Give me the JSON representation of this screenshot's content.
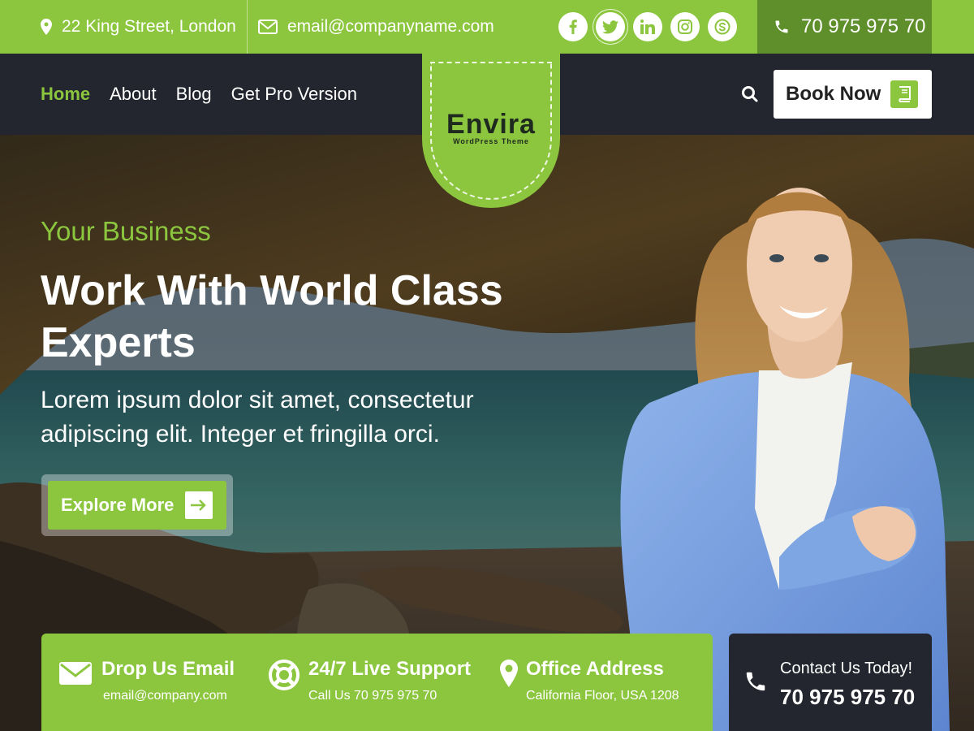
{
  "topbar": {
    "address": "22 King Street, London",
    "email": "email@companyname.com",
    "phone": "70 975 975 70",
    "social": [
      {
        "icon": "facebook-icon",
        "glyph": "f"
      },
      {
        "icon": "twitter-icon",
        "glyph": "t"
      },
      {
        "icon": "linkedin-icon",
        "glyph": "in"
      },
      {
        "icon": "instagram-icon",
        "glyph": "◎"
      },
      {
        "icon": "skype-icon",
        "glyph": "S"
      }
    ]
  },
  "nav": {
    "items": [
      "Home",
      "About",
      "Blog",
      "Get Pro Version"
    ],
    "active": "Home",
    "book_label": "Book Now"
  },
  "logo": {
    "name": "Envira",
    "tagline": "WordPress Theme"
  },
  "hero": {
    "subtitle": "Your Business",
    "title": "Work With World Class Experts",
    "description": "Lorem ipsum dolor sit amet, consectetur adipiscing elit. Integer et fringilla orci.",
    "button_label": "Explore More"
  },
  "info": [
    {
      "title": "Drop Us Email",
      "detail": "email@company.com",
      "icon": "envelope-icon"
    },
    {
      "title": "24/7 Live Support",
      "detail": "Call Us 70 975 975 70",
      "icon": "lifebuoy-icon"
    },
    {
      "title": "Office Address",
      "detail": "California Floor, USA 1208",
      "icon": "map-pin-icon"
    }
  ],
  "contact": {
    "title": "Contact Us Today!",
    "number": "70 975 975 70",
    "icon": "phone-icon"
  },
  "colors": {
    "accent": "#8cc63f",
    "dark": "#23262e",
    "phone_bg": "#5f8f2a"
  }
}
